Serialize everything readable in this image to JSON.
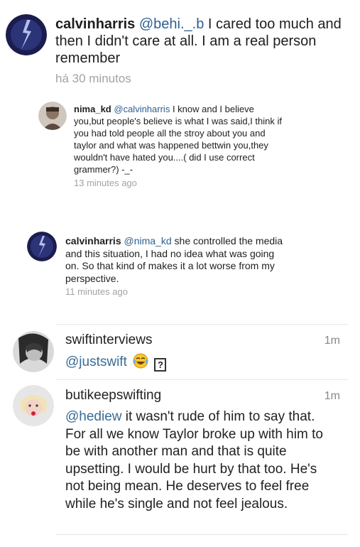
{
  "comments": [
    {
      "user": "calvinharris",
      "mention": "@behi._.b",
      "text": " I cared too much and then I didn't care at all. I am a real person remember",
      "time": "há 30 minutos"
    },
    {
      "user": "nima_kd",
      "mention": "@calvinharris",
      "text": " I know and I believe you,but people's believe is what I was said,I think if you had told people all the stroy about you and taylor and what was happened bettwin you,they wouldn't have hated you....( did I use correct grammer?) -_-",
      "time": "13 minutes ago"
    },
    {
      "user": "calvinharris",
      "mention": "@nima_kd",
      "text": " she controlled the media and this situation, I had no idea what was going on. So that kind of makes it a lot worse from my perspective.",
      "time": "11 minutes ago"
    },
    {
      "user": "swiftinterviews",
      "mention": "@justswift",
      "text": "",
      "emoji": "face-with-tears-of-joy",
      "unknown_glyph": "?",
      "time": "1m"
    },
    {
      "user": "butikeepswifting",
      "mention": "@hediew",
      "text": " it wasn't rude of him to say that. For all we know Taylor broke up with him to be with another man and that is quite upsetting. I would be hurt by that too. He's not being mean. He deserves to feel free while he's single and not feel jealous.",
      "time": "1m"
    }
  ]
}
